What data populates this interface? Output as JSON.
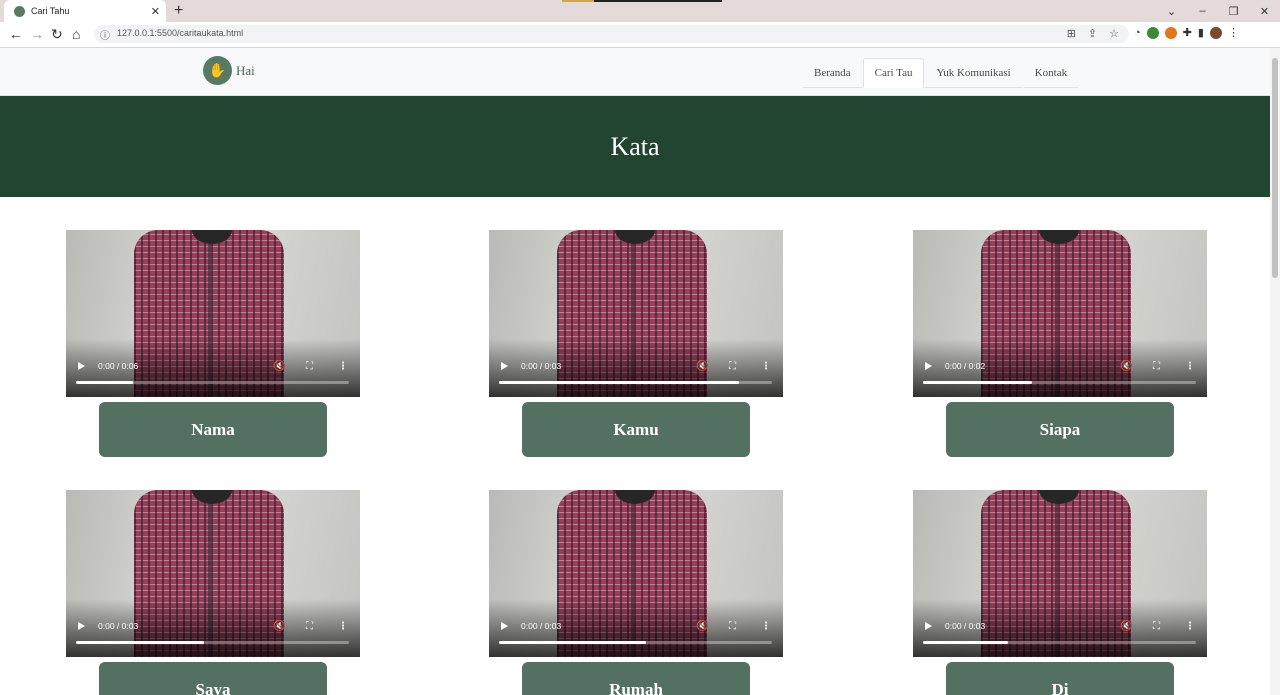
{
  "browser": {
    "tab_title": "Cari Tahu",
    "url": "127.0.0.1:5500/caritaukata.html"
  },
  "site": {
    "brand": "Hai",
    "nav": [
      "Beranda",
      "Cari Tau",
      "Yuk Komunikasi",
      "Kontak"
    ],
    "active_nav": "Cari Tau",
    "hero_title": "Kata"
  },
  "colors": {
    "hero_bg": "#214530",
    "button_bg": "#547063",
    "brand": "#587a64"
  },
  "cards": [
    {
      "word": "Nama",
      "time": "0:00 / 0:06",
      "progress": 0.21
    },
    {
      "word": "Kamu",
      "time": "0:00 / 0:03",
      "progress": 0.88
    },
    {
      "word": "Siapa",
      "time": "0:00 / 0:02",
      "progress": 0.4
    },
    {
      "word": "Saya",
      "time": "0:00 / 0:03",
      "progress": 0.47
    },
    {
      "word": "Rumah",
      "time": "0:00 / 0:03",
      "progress": 0.54
    },
    {
      "word": "Di",
      "time": "0:00 / 0:03",
      "progress": 0.31
    }
  ]
}
